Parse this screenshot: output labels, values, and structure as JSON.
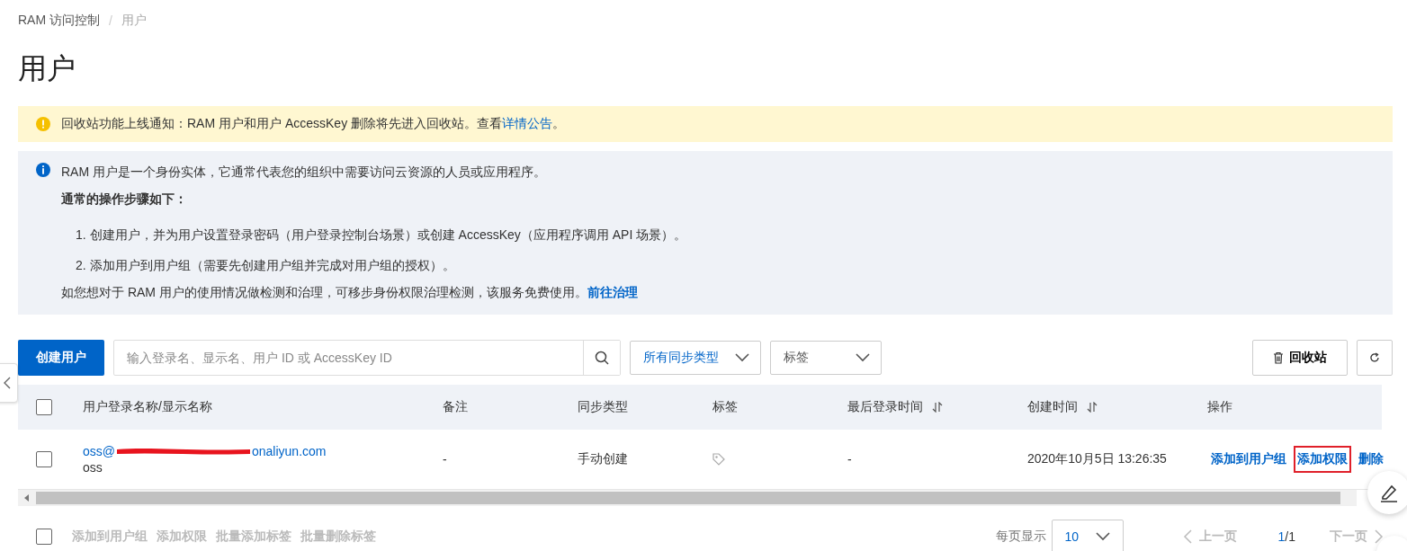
{
  "breadcrumb": {
    "items": [
      "RAM 访问控制",
      "用户"
    ],
    "separator": "/"
  },
  "title": "用户",
  "notice": {
    "text": "回收站功能上线通知：RAM 用户和用户 AccessKey 删除将先进入回收站。查看",
    "link": "详情公告",
    "after": "。"
  },
  "info": {
    "intro": "RAM 用户是一个身份实体，它通常代表您的组织中需要访问云资源的人员或应用程序。",
    "heading": "通常的操作步骤如下：",
    "steps": [
      {
        "number": "1.",
        "text": "创建用户，并为用户设置登录密码（用户登录控制台场景）或创建 AccessKey（应用程序调用 API 场景）。"
      },
      {
        "number": "2.",
        "text": "添加用户到用户组（需要先创建用户组并完成对用户组的授权）。"
      }
    ],
    "footer": "如您想对于 RAM 用户的使用情况做检测和治理，可移步身份权限治理检测，该服务免费使用。",
    "footer_link": "前往治理"
  },
  "toolbar": {
    "create_button": "创建用户",
    "search": {
      "placeholder": "输入登录名、显示名、用户 ID 或 AccessKey ID"
    },
    "sync_filter": "所有同步类型",
    "tag_filter": "标签",
    "recycle_button": "回收站"
  },
  "table": {
    "select_all": {
      "checked": false
    },
    "columns": [
      {
        "label": "用户登录名称/显示名称",
        "sortable": false
      },
      {
        "label": "备注",
        "sortable": false
      },
      {
        "label": "同步类型",
        "sortable": false
      },
      {
        "label": "标签",
        "sortable": false
      },
      {
        "label": "最后登录时间",
        "sortable": true
      },
      {
        "label": "创建时间",
        "sortable": true
      },
      {
        "label": "操作",
        "sortable": false
      }
    ],
    "rows": [
      {
        "checked": false,
        "login_name_start": "oss@",
        "login_name_end": "onaliyun.com",
        "redacted": true,
        "display_name": "oss",
        "note": "-",
        "sync_type": "手动创建",
        "last_login": "-",
        "created": "2020年10月5日 13:26:35",
        "actions": [
          {
            "label": "添加到用户组",
            "highlighted": false
          },
          {
            "label": "添加权限",
            "highlighted": true
          },
          {
            "label": "删除",
            "highlighted": false
          }
        ]
      }
    ]
  },
  "footer": {
    "select_all": {
      "checked": false
    },
    "batch_actions": [
      {
        "label": "添加到用户组",
        "disabled": true
      },
      {
        "label": "添加权限",
        "disabled": true
      },
      {
        "label": "批量添加标签",
        "disabled": true
      },
      {
        "label": "批量删除标签",
        "disabled": true
      }
    ],
    "page_size_label": "每页显示",
    "page_size": "10",
    "prev": {
      "label": "上一页",
      "disabled": true
    },
    "current_page": "1",
    "total_pages": "/1",
    "next": {
      "label": "下一页",
      "disabled": true
    }
  }
}
